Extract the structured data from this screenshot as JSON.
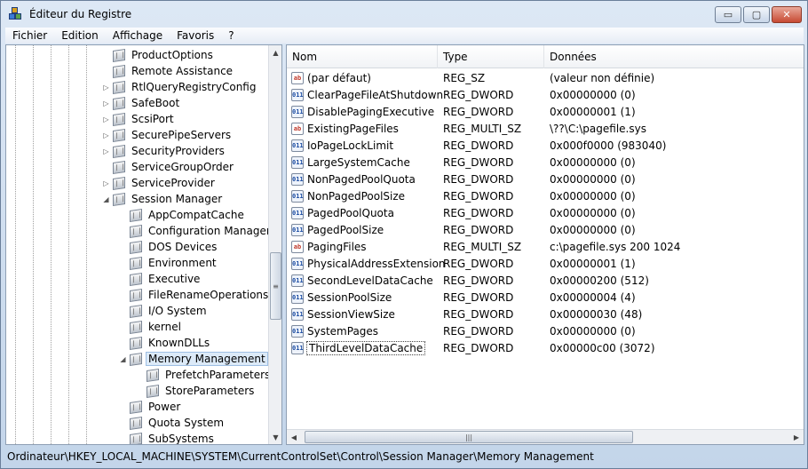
{
  "window": {
    "title": "Éditeur du Registre",
    "minimize_label": "▭",
    "maximize_label": "▢",
    "close_label": "✕"
  },
  "menu": [
    "Fichier",
    "Edition",
    "Affichage",
    "Favoris",
    "?"
  ],
  "tree": {
    "nodes": [
      {
        "label": "ProductOptions",
        "level": 0,
        "expander": ""
      },
      {
        "label": "Remote Assistance",
        "level": 0,
        "expander": ""
      },
      {
        "label": "RtlQueryRegistryConfig",
        "level": 0,
        "expander": "▷"
      },
      {
        "label": "SafeBoot",
        "level": 0,
        "expander": "▷"
      },
      {
        "label": "ScsiPort",
        "level": 0,
        "expander": "▷"
      },
      {
        "label": "SecurePipeServers",
        "level": 0,
        "expander": "▷"
      },
      {
        "label": "SecurityProviders",
        "level": 0,
        "expander": "▷"
      },
      {
        "label": "ServiceGroupOrder",
        "level": 0,
        "expander": ""
      },
      {
        "label": "ServiceProvider",
        "level": 0,
        "expander": "▷"
      },
      {
        "label": "Session Manager",
        "level": 0,
        "expander": "◢"
      },
      {
        "label": "AppCompatCache",
        "level": 1,
        "expander": ""
      },
      {
        "label": "Configuration Manager",
        "level": 1,
        "expander": ""
      },
      {
        "label": "DOS Devices",
        "level": 1,
        "expander": ""
      },
      {
        "label": "Environment",
        "level": 1,
        "expander": ""
      },
      {
        "label": "Executive",
        "level": 1,
        "expander": ""
      },
      {
        "label": "FileRenameOperations",
        "level": 1,
        "expander": ""
      },
      {
        "label": "I/O System",
        "level": 1,
        "expander": ""
      },
      {
        "label": "kernel",
        "level": 1,
        "expander": ""
      },
      {
        "label": "KnownDLLs",
        "level": 1,
        "expander": ""
      },
      {
        "label": "Memory Management",
        "level": 1,
        "expander": "◢",
        "selected": true
      },
      {
        "label": "PrefetchParameters",
        "level": 2,
        "expander": ""
      },
      {
        "label": "StoreParameters",
        "level": 2,
        "expander": ""
      },
      {
        "label": "Power",
        "level": 1,
        "expander": ""
      },
      {
        "label": "Quota System",
        "level": 1,
        "expander": ""
      },
      {
        "label": "SubSystems",
        "level": 1,
        "expander": ""
      }
    ],
    "scroll_up": "▲",
    "scroll_down": "▼",
    "scroll_grip": "≡"
  },
  "list": {
    "headers": {
      "name": "Nom",
      "type": "Type",
      "data": "Données"
    },
    "rows": [
      {
        "icon": "ab",
        "name": "(par défaut)",
        "type": "REG_SZ",
        "data": "(valeur non définie)"
      },
      {
        "icon": "dw",
        "name": "ClearPageFileAtShutdown",
        "type": "REG_DWORD",
        "data": "0x00000000 (0)"
      },
      {
        "icon": "dw",
        "name": "DisablePagingExecutive",
        "type": "REG_DWORD",
        "data": "0x00000001 (1)"
      },
      {
        "icon": "ab",
        "name": "ExistingPageFiles",
        "type": "REG_MULTI_SZ",
        "data": "\\??\\C:\\pagefile.sys"
      },
      {
        "icon": "dw",
        "name": "IoPageLockLimit",
        "type": "REG_DWORD",
        "data": "0x000f0000 (983040)"
      },
      {
        "icon": "dw",
        "name": "LargeSystemCache",
        "type": "REG_DWORD",
        "data": "0x00000000 (0)"
      },
      {
        "icon": "dw",
        "name": "NonPagedPoolQuota",
        "type": "REG_DWORD",
        "data": "0x00000000 (0)"
      },
      {
        "icon": "dw",
        "name": "NonPagedPoolSize",
        "type": "REG_DWORD",
        "data": "0x00000000 (0)"
      },
      {
        "icon": "dw",
        "name": "PagedPoolQuota",
        "type": "REG_DWORD",
        "data": "0x00000000 (0)"
      },
      {
        "icon": "dw",
        "name": "PagedPoolSize",
        "type": "REG_DWORD",
        "data": "0x00000000 (0)"
      },
      {
        "icon": "ab",
        "name": "PagingFiles",
        "type": "REG_MULTI_SZ",
        "data": "c:\\pagefile.sys 200 1024"
      },
      {
        "icon": "dw",
        "name": "PhysicalAddressExtension",
        "type": "REG_DWORD",
        "data": "0x00000001 (1)"
      },
      {
        "icon": "dw",
        "name": "SecondLevelDataCache",
        "type": "REG_DWORD",
        "data": "0x00000200 (512)"
      },
      {
        "icon": "dw",
        "name": "SessionPoolSize",
        "type": "REG_DWORD",
        "data": "0x00000004 (4)"
      },
      {
        "icon": "dw",
        "name": "SessionViewSize",
        "type": "REG_DWORD",
        "data": "0x00000030 (48)"
      },
      {
        "icon": "dw",
        "name": "SystemPages",
        "type": "REG_DWORD",
        "data": "0x00000000 (0)"
      },
      {
        "icon": "dw",
        "name": "ThirdLevelDataCache",
        "type": "REG_DWORD",
        "data": "0x00000c00 (3072)",
        "focused": true
      }
    ],
    "scroll_left": "◀",
    "scroll_right": "▶",
    "scroll_grip": "|||"
  },
  "icons": {
    "sz_glyph": "ab",
    "dword_glyph": "011"
  },
  "statusbar": {
    "path": "Ordinateur\\HKEY_LOCAL_MACHINE\\SYSTEM\\CurrentControlSet\\Control\\Session Manager\\Memory Management"
  }
}
